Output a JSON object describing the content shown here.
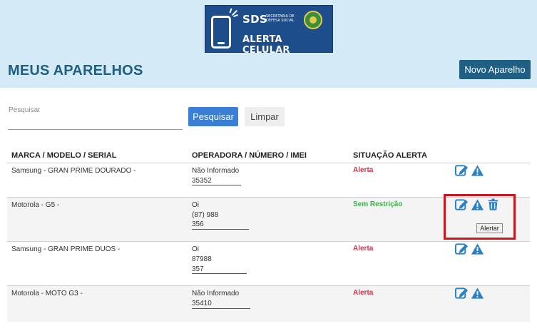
{
  "logo": {
    "brand": "SDS",
    "subtitle": "SECRETARIA DE DEFESA SOCIAL",
    "product": "ALERTA CELULAR"
  },
  "page": {
    "title": "MEUS APARELHOS",
    "new_button": "Novo Aparelho"
  },
  "search": {
    "label": "Pesquisar",
    "value": "",
    "placeholder": "",
    "search_button": "Pesquisar",
    "clear_button": "Limpar"
  },
  "table": {
    "headers": [
      "MARCA / MODELO / SERIAL",
      "OPERADORA / NÚMERO / IMEI",
      "SITUAÇÃO ALERTA",
      ""
    ],
    "rows": [
      {
        "device": "Samsung - GRAN PRIME DOURADO -",
        "carrier": "Não Informado",
        "number": "",
        "imei": "35352",
        "status": "Alerta",
        "status_type": "alert",
        "actions": [
          "edit-icon",
          "warning-icon"
        ]
      },
      {
        "device": "Motorola - G5 -",
        "carrier": "Oi",
        "number": "(87) 988",
        "imei": "356",
        "status": "Sem Restrição",
        "status_type": "ok",
        "actions": [
          "edit-icon",
          "warning-icon",
          "trash-icon"
        ]
      },
      {
        "device": "Samsung - GRAN PRIME DUOS -",
        "carrier": "Oi",
        "number": "87988",
        "imei": "357",
        "status": "Alerta",
        "status_type": "alert",
        "actions": [
          "edit-icon",
          "warning-icon"
        ]
      },
      {
        "device": "Motorola - MOTO G3 -",
        "carrier": "Não Informado",
        "number": "",
        "imei": "35410",
        "status": "Alerta",
        "status_type": "alert",
        "actions": [
          "edit-icon",
          "warning-icon"
        ]
      }
    ]
  },
  "tooltip": {
    "text": "Alertar"
  },
  "colors": {
    "header_bg": "#d4eaf7",
    "title": "#1f5f84",
    "primary_button": "#3a7fd5",
    "alert": "#d0334d",
    "ok": "#3fae49",
    "highlight": "#d0141c",
    "icon": "#2b7fc4"
  }
}
